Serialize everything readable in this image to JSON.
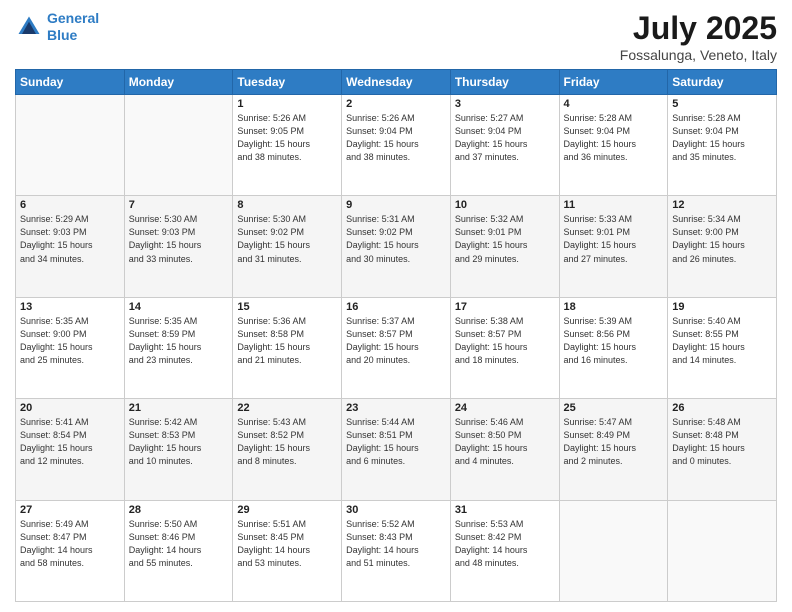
{
  "header": {
    "logo_line1": "General",
    "logo_line2": "Blue",
    "month": "July 2025",
    "location": "Fossalunga, Veneto, Italy"
  },
  "weekdays": [
    "Sunday",
    "Monday",
    "Tuesday",
    "Wednesday",
    "Thursday",
    "Friday",
    "Saturday"
  ],
  "weeks": [
    [
      {
        "num": "",
        "info": ""
      },
      {
        "num": "",
        "info": ""
      },
      {
        "num": "1",
        "info": "Sunrise: 5:26 AM\nSunset: 9:05 PM\nDaylight: 15 hours\nand 38 minutes."
      },
      {
        "num": "2",
        "info": "Sunrise: 5:26 AM\nSunset: 9:04 PM\nDaylight: 15 hours\nand 38 minutes."
      },
      {
        "num": "3",
        "info": "Sunrise: 5:27 AM\nSunset: 9:04 PM\nDaylight: 15 hours\nand 37 minutes."
      },
      {
        "num": "4",
        "info": "Sunrise: 5:28 AM\nSunset: 9:04 PM\nDaylight: 15 hours\nand 36 minutes."
      },
      {
        "num": "5",
        "info": "Sunrise: 5:28 AM\nSunset: 9:04 PM\nDaylight: 15 hours\nand 35 minutes."
      }
    ],
    [
      {
        "num": "6",
        "info": "Sunrise: 5:29 AM\nSunset: 9:03 PM\nDaylight: 15 hours\nand 34 minutes."
      },
      {
        "num": "7",
        "info": "Sunrise: 5:30 AM\nSunset: 9:03 PM\nDaylight: 15 hours\nand 33 minutes."
      },
      {
        "num": "8",
        "info": "Sunrise: 5:30 AM\nSunset: 9:02 PM\nDaylight: 15 hours\nand 31 minutes."
      },
      {
        "num": "9",
        "info": "Sunrise: 5:31 AM\nSunset: 9:02 PM\nDaylight: 15 hours\nand 30 minutes."
      },
      {
        "num": "10",
        "info": "Sunrise: 5:32 AM\nSunset: 9:01 PM\nDaylight: 15 hours\nand 29 minutes."
      },
      {
        "num": "11",
        "info": "Sunrise: 5:33 AM\nSunset: 9:01 PM\nDaylight: 15 hours\nand 27 minutes."
      },
      {
        "num": "12",
        "info": "Sunrise: 5:34 AM\nSunset: 9:00 PM\nDaylight: 15 hours\nand 26 minutes."
      }
    ],
    [
      {
        "num": "13",
        "info": "Sunrise: 5:35 AM\nSunset: 9:00 PM\nDaylight: 15 hours\nand 25 minutes."
      },
      {
        "num": "14",
        "info": "Sunrise: 5:35 AM\nSunset: 8:59 PM\nDaylight: 15 hours\nand 23 minutes."
      },
      {
        "num": "15",
        "info": "Sunrise: 5:36 AM\nSunset: 8:58 PM\nDaylight: 15 hours\nand 21 minutes."
      },
      {
        "num": "16",
        "info": "Sunrise: 5:37 AM\nSunset: 8:57 PM\nDaylight: 15 hours\nand 20 minutes."
      },
      {
        "num": "17",
        "info": "Sunrise: 5:38 AM\nSunset: 8:57 PM\nDaylight: 15 hours\nand 18 minutes."
      },
      {
        "num": "18",
        "info": "Sunrise: 5:39 AM\nSunset: 8:56 PM\nDaylight: 15 hours\nand 16 minutes."
      },
      {
        "num": "19",
        "info": "Sunrise: 5:40 AM\nSunset: 8:55 PM\nDaylight: 15 hours\nand 14 minutes."
      }
    ],
    [
      {
        "num": "20",
        "info": "Sunrise: 5:41 AM\nSunset: 8:54 PM\nDaylight: 15 hours\nand 12 minutes."
      },
      {
        "num": "21",
        "info": "Sunrise: 5:42 AM\nSunset: 8:53 PM\nDaylight: 15 hours\nand 10 minutes."
      },
      {
        "num": "22",
        "info": "Sunrise: 5:43 AM\nSunset: 8:52 PM\nDaylight: 15 hours\nand 8 minutes."
      },
      {
        "num": "23",
        "info": "Sunrise: 5:44 AM\nSunset: 8:51 PM\nDaylight: 15 hours\nand 6 minutes."
      },
      {
        "num": "24",
        "info": "Sunrise: 5:46 AM\nSunset: 8:50 PM\nDaylight: 15 hours\nand 4 minutes."
      },
      {
        "num": "25",
        "info": "Sunrise: 5:47 AM\nSunset: 8:49 PM\nDaylight: 15 hours\nand 2 minutes."
      },
      {
        "num": "26",
        "info": "Sunrise: 5:48 AM\nSunset: 8:48 PM\nDaylight: 15 hours\nand 0 minutes."
      }
    ],
    [
      {
        "num": "27",
        "info": "Sunrise: 5:49 AM\nSunset: 8:47 PM\nDaylight: 14 hours\nand 58 minutes."
      },
      {
        "num": "28",
        "info": "Sunrise: 5:50 AM\nSunset: 8:46 PM\nDaylight: 14 hours\nand 55 minutes."
      },
      {
        "num": "29",
        "info": "Sunrise: 5:51 AM\nSunset: 8:45 PM\nDaylight: 14 hours\nand 53 minutes."
      },
      {
        "num": "30",
        "info": "Sunrise: 5:52 AM\nSunset: 8:43 PM\nDaylight: 14 hours\nand 51 minutes."
      },
      {
        "num": "31",
        "info": "Sunrise: 5:53 AM\nSunset: 8:42 PM\nDaylight: 14 hours\nand 48 minutes."
      },
      {
        "num": "",
        "info": ""
      },
      {
        "num": "",
        "info": ""
      }
    ]
  ]
}
